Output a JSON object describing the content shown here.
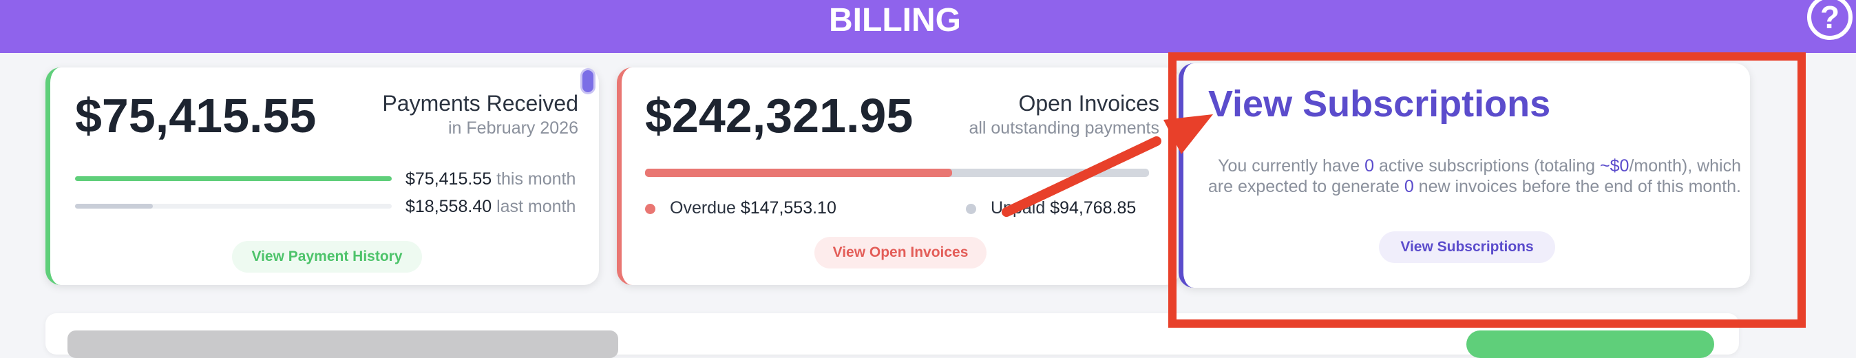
{
  "header": {
    "title": "BILLING",
    "help_glyph": "?"
  },
  "payments": {
    "amount": "$75,415.55",
    "heading": "Payments Received",
    "subheading": "in February 2026",
    "this_month_amount": "$75,415.55",
    "this_month_label": "this month",
    "last_month_amount": "$18,558.40",
    "last_month_label": "last month",
    "this_month_fraction": 1.0,
    "last_month_fraction": 0.246,
    "button": "View Payment History",
    "accent": "#5fcf7a"
  },
  "invoices": {
    "amount": "$242,321.95",
    "heading": "Open Invoices",
    "subheading": "all outstanding payments",
    "overdue_label": "Overdue",
    "overdue_amount": "$147,553.10",
    "unpaid_label": "Unpaid",
    "unpaid_amount": "$94,768.85",
    "overdue_fraction": 0.609,
    "button": "View Open Invoices",
    "accent": "#e97672"
  },
  "subscriptions": {
    "title": "View Subscriptions",
    "text_1": "You currently have ",
    "active_count": "0",
    "text_2": " active subscriptions (totaling ",
    "monthly_total": "~$0",
    "text_3": "/month), which are expected to generate ",
    "invoice_count": "0",
    "text_4": " new invoices before the end of this month.",
    "button": "View Subscriptions",
    "accent": "#5b4ccc"
  },
  "annotation": {
    "color": "#e8402a"
  }
}
